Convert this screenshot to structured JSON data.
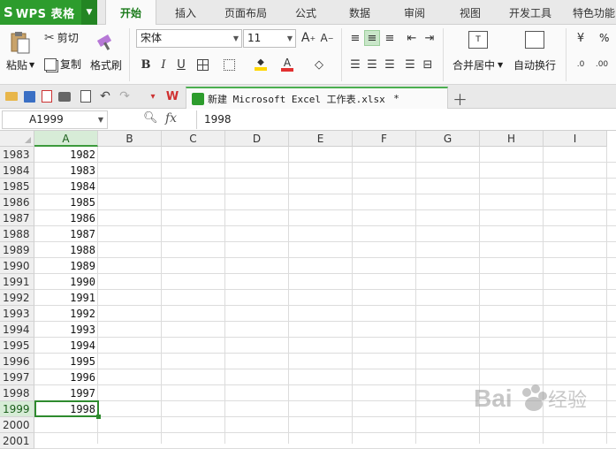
{
  "app": {
    "title": "WPS 表格"
  },
  "menu": {
    "tabs": [
      "开始",
      "插入",
      "页面布局",
      "公式",
      "数据",
      "审阅",
      "视图",
      "开发工具",
      "特色功能"
    ],
    "active_index": 0
  },
  "ribbon": {
    "paste": "粘贴",
    "cut": "剪切",
    "copy": "复制",
    "format_painter": "格式刷",
    "font_name": "宋体",
    "font_size": "11",
    "merge_center": "合并居中",
    "wrap_text": "自动换行",
    "percent": "%"
  },
  "document": {
    "tab_name": "新建 Microsoft Excel 工作表.xlsx",
    "modified_mark": "*"
  },
  "formula_bar": {
    "name_box": "A1999",
    "fx_label": "fx",
    "value": "1998"
  },
  "sheet": {
    "columns": [
      "A",
      "B",
      "C",
      "D",
      "E",
      "F",
      "G",
      "H",
      "I"
    ],
    "rows": [
      {
        "row": "1983",
        "a": "1982"
      },
      {
        "row": "1984",
        "a": "1983"
      },
      {
        "row": "1985",
        "a": "1984"
      },
      {
        "row": "1986",
        "a": "1985"
      },
      {
        "row": "1987",
        "a": "1986"
      },
      {
        "row": "1988",
        "a": "1987"
      },
      {
        "row": "1989",
        "a": "1988"
      },
      {
        "row": "1990",
        "a": "1989"
      },
      {
        "row": "1991",
        "a": "1990"
      },
      {
        "row": "1992",
        "a": "1991"
      },
      {
        "row": "1993",
        "a": "1992"
      },
      {
        "row": "1994",
        "a": "1993"
      },
      {
        "row": "1995",
        "a": "1994"
      },
      {
        "row": "1996",
        "a": "1995"
      },
      {
        "row": "1997",
        "a": "1996"
      },
      {
        "row": "1998",
        "a": "1997"
      },
      {
        "row": "1999",
        "a": "1998"
      },
      {
        "row": "2000",
        "a": ""
      },
      {
        "row": "2001",
        "a": ""
      }
    ],
    "active_row_index": 16,
    "active_column": "A"
  },
  "colors": {
    "accent": "#2d9c2d",
    "selection": "#2e8b2e"
  }
}
